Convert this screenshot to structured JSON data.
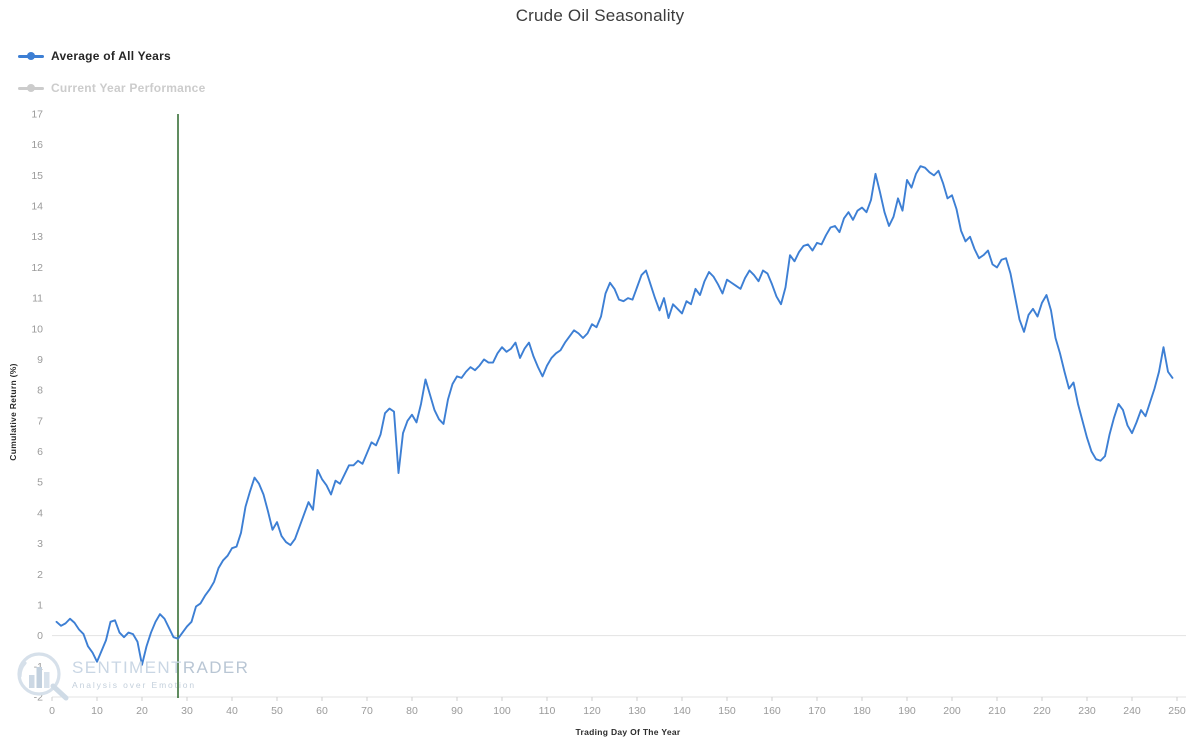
{
  "header": {
    "title": "Crude Oil Seasonality"
  },
  "legend": {
    "position": "top-left",
    "items": [
      {
        "label": "Average of All Years",
        "color": "#3d7fd4",
        "state": "active",
        "marker": "line-dot"
      },
      {
        "label": "Current Year Performance",
        "color": "#cccccc",
        "state": "inactive",
        "marker": "line-dot"
      }
    ]
  },
  "watermark": {
    "name_part1": "SENTIMENT",
    "name_part2": "RADER",
    "tagline": "Analysis over Emotion",
    "icon": "magnifier-bars-logo"
  },
  "annotations": {
    "vertical_line": {
      "label": "current-day-marker",
      "x": 28,
      "color": "#1c5c1c"
    }
  },
  "chart_data": {
    "type": "line",
    "title": "Crude Oil Seasonality",
    "xlabel": "Trading Day Of The Year",
    "ylabel": "Cumulative Return (%)",
    "xlim": [
      0,
      252
    ],
    "ylim": [
      -2,
      17
    ],
    "xticks": [
      0,
      10,
      20,
      30,
      40,
      50,
      60,
      70,
      80,
      90,
      100,
      110,
      120,
      130,
      140,
      150,
      160,
      170,
      180,
      190,
      200,
      210,
      220,
      230,
      240,
      250
    ],
    "yticks": [
      -2,
      -1,
      0,
      1,
      2,
      3,
      4,
      5,
      6,
      7,
      8,
      9,
      10,
      11,
      12,
      13,
      14,
      15,
      16,
      17
    ],
    "grid": "horizontal-faint",
    "legend_position": "top-left",
    "zero_line": 0,
    "series": [
      {
        "name": "Average of All Years",
        "color": "#3d7fd4",
        "x": [
          1,
          2,
          3,
          4,
          5,
          6,
          7,
          8,
          9,
          10,
          11,
          12,
          13,
          14,
          15,
          16,
          17,
          18,
          19,
          20,
          21,
          22,
          23,
          24,
          25,
          26,
          27,
          28,
          29,
          30,
          31,
          32,
          33,
          34,
          35,
          36,
          37,
          38,
          39,
          40,
          41,
          42,
          43,
          44,
          45,
          46,
          47,
          48,
          49,
          50,
          51,
          52,
          53,
          54,
          55,
          56,
          57,
          58,
          59,
          60,
          61,
          62,
          63,
          64,
          65,
          66,
          67,
          68,
          69,
          70,
          71,
          72,
          73,
          74,
          75,
          76,
          77,
          78,
          79,
          80,
          81,
          82,
          83,
          84,
          85,
          86,
          87,
          88,
          89,
          90,
          91,
          92,
          93,
          94,
          95,
          96,
          97,
          98,
          99,
          100,
          101,
          102,
          103,
          104,
          105,
          106,
          107,
          108,
          109,
          110,
          111,
          112,
          113,
          114,
          115,
          116,
          117,
          118,
          119,
          120,
          121,
          122,
          123,
          124,
          125,
          126,
          127,
          128,
          129,
          130,
          131,
          132,
          133,
          134,
          135,
          136,
          137,
          138,
          139,
          140,
          141,
          142,
          143,
          144,
          145,
          146,
          147,
          148,
          149,
          150,
          151,
          152,
          153,
          154,
          155,
          156,
          157,
          158,
          159,
          160,
          161,
          162,
          163,
          164,
          165,
          166,
          167,
          168,
          169,
          170,
          171,
          172,
          173,
          174,
          175,
          176,
          177,
          178,
          179,
          180,
          181,
          182,
          183,
          184,
          185,
          186,
          187,
          188,
          189,
          190,
          191,
          192,
          193,
          194,
          195,
          196,
          197,
          198,
          199,
          200,
          201,
          202,
          203,
          204,
          205,
          206,
          207,
          208,
          209,
          210,
          211,
          212,
          213,
          214,
          215,
          216,
          217,
          218,
          219,
          220,
          221,
          222,
          223,
          224,
          225,
          226,
          227,
          228,
          229,
          230,
          231,
          232,
          233,
          234,
          235,
          236,
          237,
          238,
          239,
          240,
          241,
          242,
          243,
          244,
          245,
          246,
          247,
          248,
          249,
          250,
          251
        ],
        "values": [
          0.45,
          0.32,
          0.4,
          0.55,
          0.42,
          0.2,
          0.05,
          -0.35,
          -0.55,
          -0.85,
          -0.5,
          -0.15,
          0.45,
          0.5,
          0.1,
          -0.05,
          0.1,
          0.05,
          -0.2,
          -0.95,
          -0.35,
          0.1,
          0.45,
          0.7,
          0.55,
          0.25,
          -0.05,
          -0.1,
          0.1,
          0.3,
          0.45,
          0.95,
          1.05,
          1.3,
          1.5,
          1.75,
          2.2,
          2.45,
          2.6,
          2.85,
          2.9,
          3.35,
          4.2,
          4.7,
          5.15,
          4.95,
          4.6,
          4.05,
          3.45,
          3.7,
          3.25,
          3.05,
          2.95,
          3.15,
          3.55,
          3.95,
          4.35,
          4.1,
          5.4,
          5.1,
          4.9,
          4.6,
          5.05,
          4.95,
          5.25,
          5.55,
          5.55,
          5.7,
          5.6,
          5.95,
          6.3,
          6.2,
          6.55,
          7.25,
          7.4,
          7.3,
          5.3,
          6.6,
          7.0,
          7.2,
          6.95,
          7.55,
          8.35,
          7.85,
          7.35,
          7.05,
          6.9,
          7.7,
          8.2,
          8.45,
          8.4,
          8.6,
          8.75,
          8.65,
          8.8,
          9.0,
          8.9,
          8.9,
          9.2,
          9.4,
          9.25,
          9.35,
          9.55,
          9.05,
          9.35,
          9.55,
          9.1,
          8.75,
          8.45,
          8.8,
          9.05,
          9.2,
          9.3,
          9.55,
          9.75,
          9.95,
          9.85,
          9.7,
          9.85,
          10.15,
          10.05,
          10.4,
          11.15,
          11.5,
          11.3,
          10.95,
          10.9,
          11.0,
          10.95,
          11.35,
          11.75,
          11.9,
          11.45,
          11.0,
          10.6,
          11.0,
          10.35,
          10.8,
          10.65,
          10.5,
          10.9,
          10.8,
          11.3,
          11.1,
          11.55,
          11.85,
          11.7,
          11.45,
          11.15,
          11.6,
          11.5,
          11.4,
          11.3,
          11.65,
          11.9,
          11.75,
          11.55,
          11.9,
          11.8,
          11.45,
          11.05,
          10.8,
          11.35,
          12.4,
          12.2,
          12.5,
          12.7,
          12.75,
          12.55,
          12.8,
          12.75,
          13.05,
          13.3,
          13.35,
          13.15,
          13.6,
          13.8,
          13.55,
          13.85,
          13.95,
          13.8,
          14.2,
          15.05,
          14.45,
          13.8,
          13.35,
          13.65,
          14.25,
          13.85,
          14.85,
          14.6,
          15.05,
          15.3,
          15.25,
          15.1,
          15.0,
          15.15,
          14.75,
          14.25,
          14.35,
          13.9,
          13.2,
          12.85,
          13.0,
          12.6,
          12.3,
          12.4,
          12.55,
          12.1,
          12.0,
          12.25,
          12.3,
          11.8,
          11.05,
          10.3,
          9.9,
          10.45,
          10.65,
          10.4,
          10.85,
          11.1,
          10.6,
          9.7,
          9.2,
          8.6,
          8.05,
          8.25,
          7.55,
          7.0,
          6.45,
          6.0,
          5.75,
          5.7,
          5.85,
          6.55,
          7.1,
          7.55,
          7.35,
          6.85,
          6.6,
          6.95,
          7.35,
          7.15,
          7.6,
          8.05,
          8.6,
          9.4,
          8.6,
          8.4
        ]
      }
    ]
  }
}
